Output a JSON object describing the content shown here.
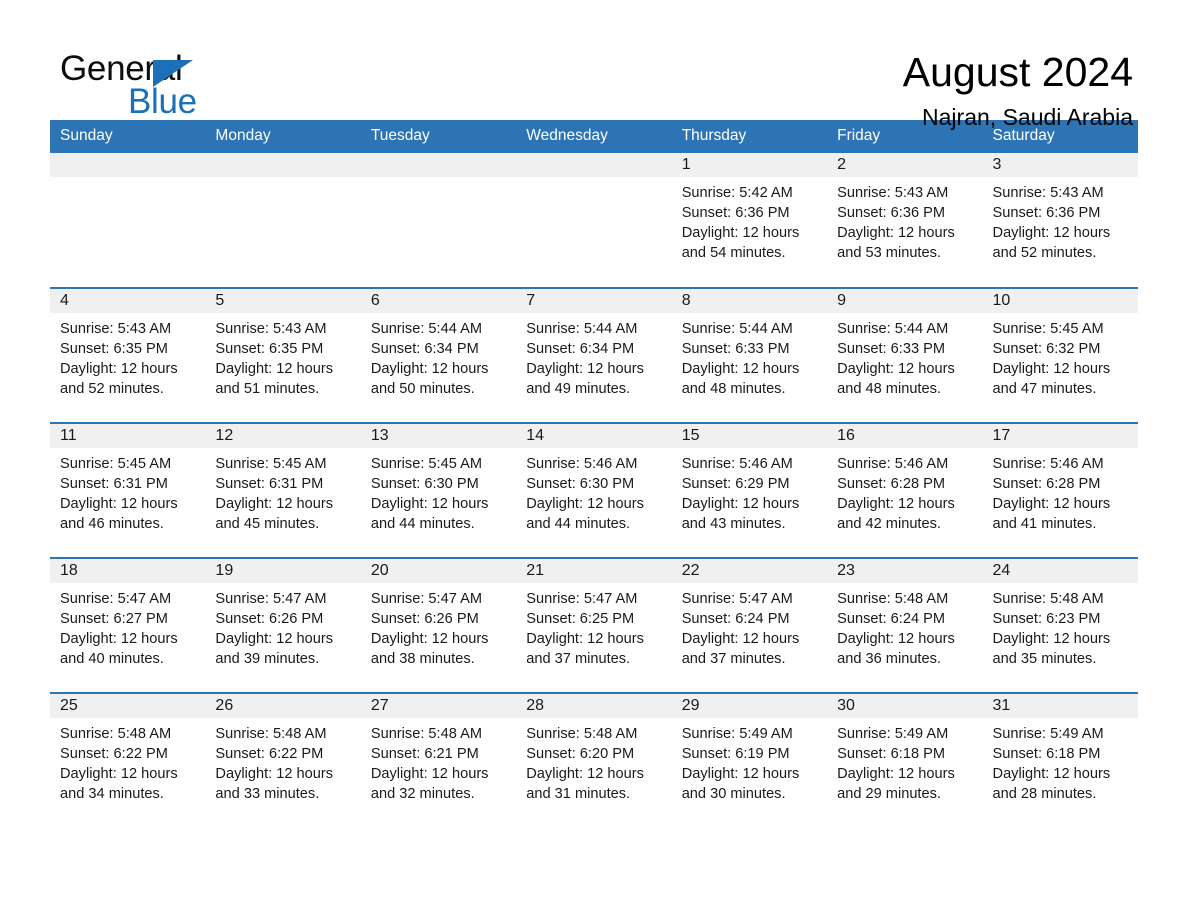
{
  "brand": {
    "word1": "General",
    "word2": "Blue",
    "triangle_color": "#1c70b8"
  },
  "header": {
    "month_title": "August 2024",
    "location": "Najran, Saudi Arabia",
    "header_bg": "#2d74b5",
    "daynum_bg": "#f0f0f0"
  },
  "weekdays": [
    "Sunday",
    "Monday",
    "Tuesday",
    "Wednesday",
    "Thursday",
    "Friday",
    "Saturday"
  ],
  "labels": {
    "sunrise_prefix": "Sunrise:",
    "sunset_prefix": "Sunset:",
    "daylight_prefix": "Daylight:"
  },
  "weeks": [
    [
      {
        "day": "",
        "sunrise": "",
        "sunset": "",
        "daylight_line1": "",
        "daylight_line2": ""
      },
      {
        "day": "",
        "sunrise": "",
        "sunset": "",
        "daylight_line1": "",
        "daylight_line2": ""
      },
      {
        "day": "",
        "sunrise": "",
        "sunset": "",
        "daylight_line1": "",
        "daylight_line2": ""
      },
      {
        "day": "",
        "sunrise": "",
        "sunset": "",
        "daylight_line1": "",
        "daylight_line2": ""
      },
      {
        "day": "1",
        "sunrise": "Sunrise: 5:42 AM",
        "sunset": "Sunset: 6:36 PM",
        "daylight_line1": "Daylight: 12 hours",
        "daylight_line2": "and 54 minutes."
      },
      {
        "day": "2",
        "sunrise": "Sunrise: 5:43 AM",
        "sunset": "Sunset: 6:36 PM",
        "daylight_line1": "Daylight: 12 hours",
        "daylight_line2": "and 53 minutes."
      },
      {
        "day": "3",
        "sunrise": "Sunrise: 5:43 AM",
        "sunset": "Sunset: 6:36 PM",
        "daylight_line1": "Daylight: 12 hours",
        "daylight_line2": "and 52 minutes."
      }
    ],
    [
      {
        "day": "4",
        "sunrise": "Sunrise: 5:43 AM",
        "sunset": "Sunset: 6:35 PM",
        "daylight_line1": "Daylight: 12 hours",
        "daylight_line2": "and 52 minutes."
      },
      {
        "day": "5",
        "sunrise": "Sunrise: 5:43 AM",
        "sunset": "Sunset: 6:35 PM",
        "daylight_line1": "Daylight: 12 hours",
        "daylight_line2": "and 51 minutes."
      },
      {
        "day": "6",
        "sunrise": "Sunrise: 5:44 AM",
        "sunset": "Sunset: 6:34 PM",
        "daylight_line1": "Daylight: 12 hours",
        "daylight_line2": "and 50 minutes."
      },
      {
        "day": "7",
        "sunrise": "Sunrise: 5:44 AM",
        "sunset": "Sunset: 6:34 PM",
        "daylight_line1": "Daylight: 12 hours",
        "daylight_line2": "and 49 minutes."
      },
      {
        "day": "8",
        "sunrise": "Sunrise: 5:44 AM",
        "sunset": "Sunset: 6:33 PM",
        "daylight_line1": "Daylight: 12 hours",
        "daylight_line2": "and 48 minutes."
      },
      {
        "day": "9",
        "sunrise": "Sunrise: 5:44 AM",
        "sunset": "Sunset: 6:33 PM",
        "daylight_line1": "Daylight: 12 hours",
        "daylight_line2": "and 48 minutes."
      },
      {
        "day": "10",
        "sunrise": "Sunrise: 5:45 AM",
        "sunset": "Sunset: 6:32 PM",
        "daylight_line1": "Daylight: 12 hours",
        "daylight_line2": "and 47 minutes."
      }
    ],
    [
      {
        "day": "11",
        "sunrise": "Sunrise: 5:45 AM",
        "sunset": "Sunset: 6:31 PM",
        "daylight_line1": "Daylight: 12 hours",
        "daylight_line2": "and 46 minutes."
      },
      {
        "day": "12",
        "sunrise": "Sunrise: 5:45 AM",
        "sunset": "Sunset: 6:31 PM",
        "daylight_line1": "Daylight: 12 hours",
        "daylight_line2": "and 45 minutes."
      },
      {
        "day": "13",
        "sunrise": "Sunrise: 5:45 AM",
        "sunset": "Sunset: 6:30 PM",
        "daylight_line1": "Daylight: 12 hours",
        "daylight_line2": "and 44 minutes."
      },
      {
        "day": "14",
        "sunrise": "Sunrise: 5:46 AM",
        "sunset": "Sunset: 6:30 PM",
        "daylight_line1": "Daylight: 12 hours",
        "daylight_line2": "and 44 minutes."
      },
      {
        "day": "15",
        "sunrise": "Sunrise: 5:46 AM",
        "sunset": "Sunset: 6:29 PM",
        "daylight_line1": "Daylight: 12 hours",
        "daylight_line2": "and 43 minutes."
      },
      {
        "day": "16",
        "sunrise": "Sunrise: 5:46 AM",
        "sunset": "Sunset: 6:28 PM",
        "daylight_line1": "Daylight: 12 hours",
        "daylight_line2": "and 42 minutes."
      },
      {
        "day": "17",
        "sunrise": "Sunrise: 5:46 AM",
        "sunset": "Sunset: 6:28 PM",
        "daylight_line1": "Daylight: 12 hours",
        "daylight_line2": "and 41 minutes."
      }
    ],
    [
      {
        "day": "18",
        "sunrise": "Sunrise: 5:47 AM",
        "sunset": "Sunset: 6:27 PM",
        "daylight_line1": "Daylight: 12 hours",
        "daylight_line2": "and 40 minutes."
      },
      {
        "day": "19",
        "sunrise": "Sunrise: 5:47 AM",
        "sunset": "Sunset: 6:26 PM",
        "daylight_line1": "Daylight: 12 hours",
        "daylight_line2": "and 39 minutes."
      },
      {
        "day": "20",
        "sunrise": "Sunrise: 5:47 AM",
        "sunset": "Sunset: 6:26 PM",
        "daylight_line1": "Daylight: 12 hours",
        "daylight_line2": "and 38 minutes."
      },
      {
        "day": "21",
        "sunrise": "Sunrise: 5:47 AM",
        "sunset": "Sunset: 6:25 PM",
        "daylight_line1": "Daylight: 12 hours",
        "daylight_line2": "and 37 minutes."
      },
      {
        "day": "22",
        "sunrise": "Sunrise: 5:47 AM",
        "sunset": "Sunset: 6:24 PM",
        "daylight_line1": "Daylight: 12 hours",
        "daylight_line2": "and 37 minutes."
      },
      {
        "day": "23",
        "sunrise": "Sunrise: 5:48 AM",
        "sunset": "Sunset: 6:24 PM",
        "daylight_line1": "Daylight: 12 hours",
        "daylight_line2": "and 36 minutes."
      },
      {
        "day": "24",
        "sunrise": "Sunrise: 5:48 AM",
        "sunset": "Sunset: 6:23 PM",
        "daylight_line1": "Daylight: 12 hours",
        "daylight_line2": "and 35 minutes."
      }
    ],
    [
      {
        "day": "25",
        "sunrise": "Sunrise: 5:48 AM",
        "sunset": "Sunset: 6:22 PM",
        "daylight_line1": "Daylight: 12 hours",
        "daylight_line2": "and 34 minutes."
      },
      {
        "day": "26",
        "sunrise": "Sunrise: 5:48 AM",
        "sunset": "Sunset: 6:22 PM",
        "daylight_line1": "Daylight: 12 hours",
        "daylight_line2": "and 33 minutes."
      },
      {
        "day": "27",
        "sunrise": "Sunrise: 5:48 AM",
        "sunset": "Sunset: 6:21 PM",
        "daylight_line1": "Daylight: 12 hours",
        "daylight_line2": "and 32 minutes."
      },
      {
        "day": "28",
        "sunrise": "Sunrise: 5:48 AM",
        "sunset": "Sunset: 6:20 PM",
        "daylight_line1": "Daylight: 12 hours",
        "daylight_line2": "and 31 minutes."
      },
      {
        "day": "29",
        "sunrise": "Sunrise: 5:49 AM",
        "sunset": "Sunset: 6:19 PM",
        "daylight_line1": "Daylight: 12 hours",
        "daylight_line2": "and 30 minutes."
      },
      {
        "day": "30",
        "sunrise": "Sunrise: 5:49 AM",
        "sunset": "Sunset: 6:18 PM",
        "daylight_line1": "Daylight: 12 hours",
        "daylight_line2": "and 29 minutes."
      },
      {
        "day": "31",
        "sunrise": "Sunrise: 5:49 AM",
        "sunset": "Sunset: 6:18 PM",
        "daylight_line1": "Daylight: 12 hours",
        "daylight_line2": "and 28 minutes."
      }
    ]
  ]
}
